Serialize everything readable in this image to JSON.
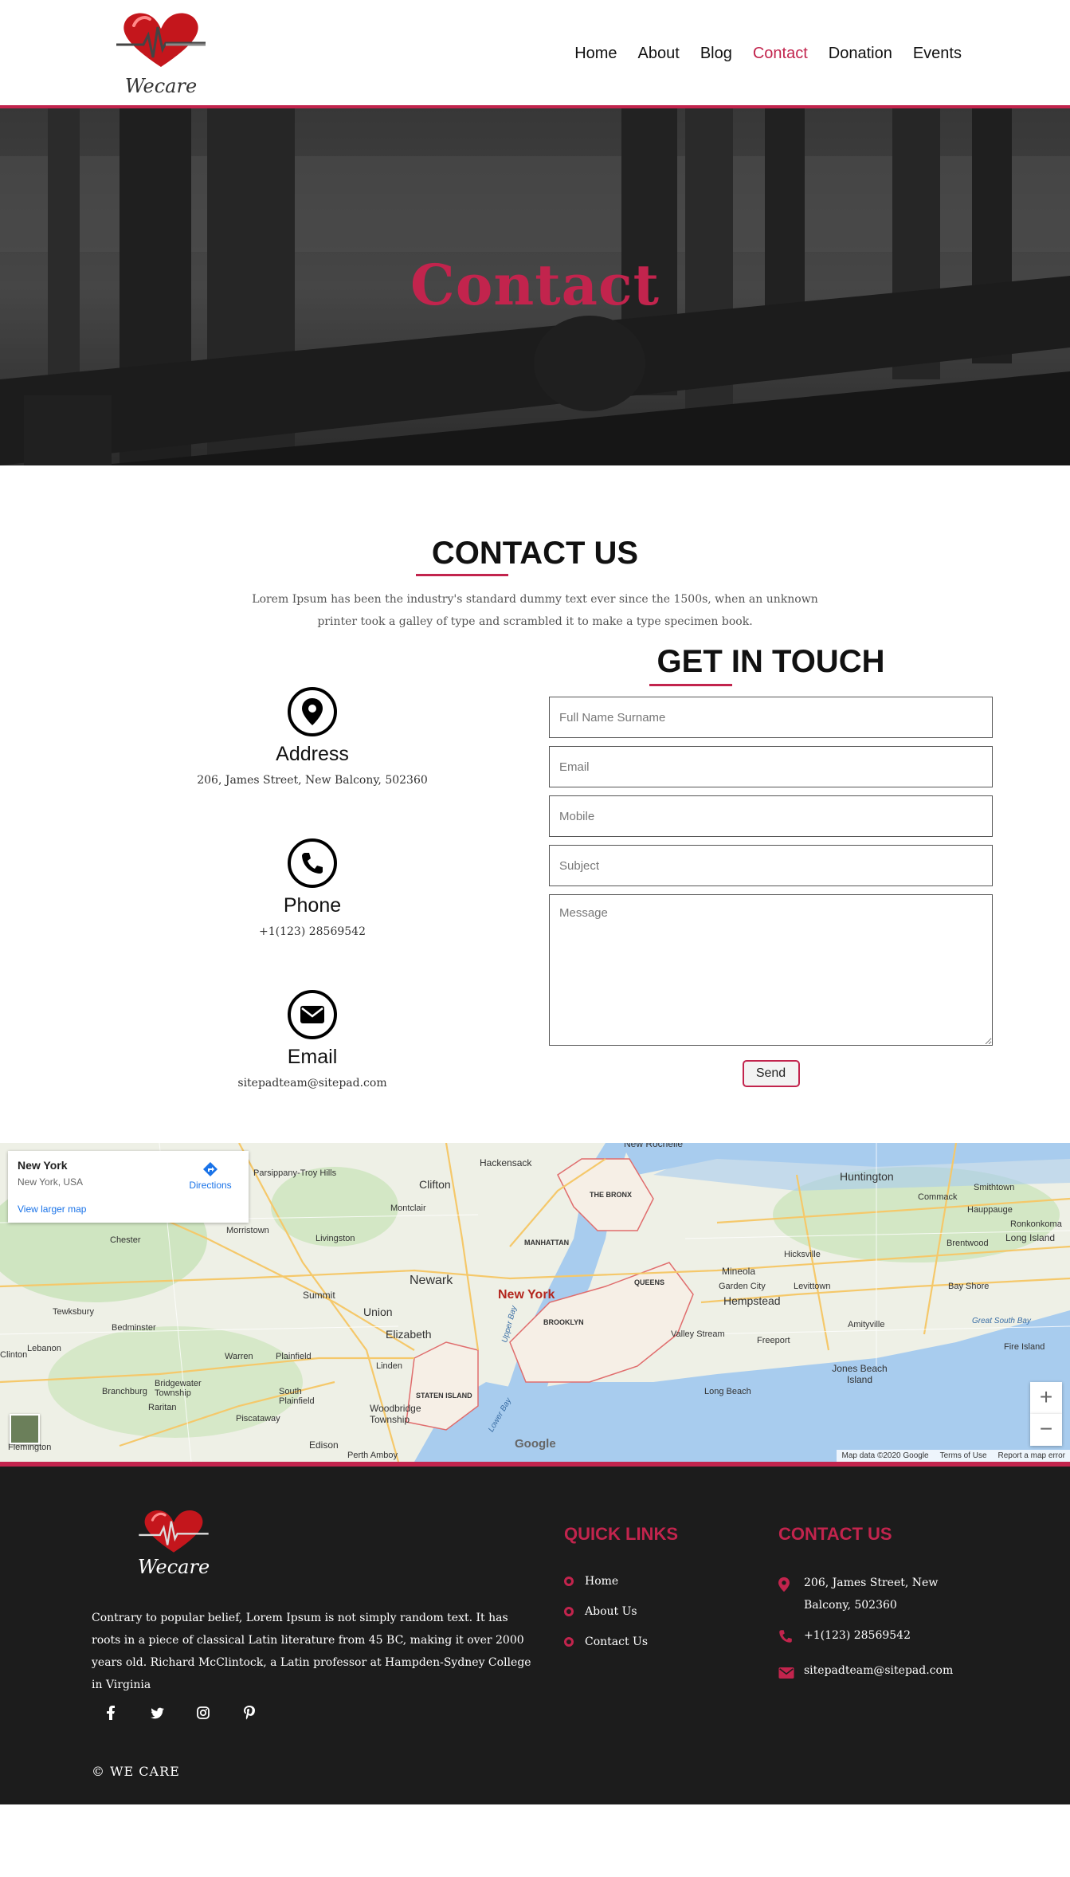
{
  "header": {
    "logo_text": "Wecare",
    "nav": [
      "Home",
      "About",
      "Blog",
      "Contact",
      "Donation",
      "Events"
    ],
    "active_nav": "Contact"
  },
  "hero": {
    "title": "Contact"
  },
  "contact": {
    "title": "CONTACT US",
    "lead": "Lorem Ipsum has been the industry's standard dummy text ever since the 1500s, when an unknown printer took a galley of type and scrambled it to make a type specimen book.",
    "items": [
      {
        "icon": "location-icon",
        "label": "Address",
        "value": "206, James Street, New Balcony, 502360"
      },
      {
        "icon": "phone-icon",
        "label": "Phone",
        "value": "+1(123) 28569542"
      },
      {
        "icon": "envelope-icon",
        "label": "Email",
        "value": "sitepadteam@sitepad.com"
      }
    ]
  },
  "form": {
    "title": "GET IN TOUCH",
    "name_placeholder": "Full Name Surname",
    "email_placeholder": "Email",
    "mobile_placeholder": "Mobile",
    "subject_placeholder": "Subject",
    "message_placeholder": "Message",
    "send_label": "Send"
  },
  "map": {
    "place_name": "New York",
    "place_address": "New York, USA",
    "directions_label": "Directions",
    "larger_map_label": "View larger map",
    "city_label": "New York",
    "zoom_in": "+",
    "zoom_out": "−",
    "google_label": "Google",
    "attribution": [
      "Map data ©2020 Google",
      "Terms of Use",
      "Report a map error"
    ],
    "labels": [
      "New Rochelle",
      "Hackensack",
      "Parsippany-Troy Hills",
      "Clifton",
      "Montclair",
      "Morristown",
      "Livingston",
      "Chester",
      "Newark",
      "Summit",
      "Union",
      "Elizabeth",
      "Tewksbury",
      "Bedminster",
      "Warren",
      "Plainfield",
      "Linden",
      "Bridgewater Township",
      "Branchburg",
      "Raritan",
      "South Plainfield",
      "Piscataway",
      "Woodbridge Township",
      "Edison",
      "Perth Amboy",
      "Flemington",
      "Lebanon",
      "STATEN ISLAND",
      "MANHATTAN",
      "THE BRONX",
      "QUEENS",
      "BROOKLYN",
      "Huntington",
      "Smithtown",
      "Commack",
      "Hauppauge",
      "Ronkonkoma",
      "Long Island",
      "Brentwood",
      "Hicksville",
      "Mineola",
      "Garden City",
      "Hempstead",
      "Levittown",
      "Bay Shore",
      "Amityville",
      "Valley Stream",
      "Freeport",
      "Great South Bay",
      "Fire Island",
      "Jones Beach Island",
      "Long Beach",
      "Lower Bay",
      "Upper Bay",
      "Clinton"
    ]
  },
  "footer": {
    "logo_text": "Wecare",
    "about": "Contrary to popular belief, Lorem Ipsum is not simply random text. It has roots in a piece of classical Latin literature from 45 BC, making it over 2000 years old. Richard McClintock, a Latin professor at Hampden-Sydney College in Virginia",
    "quick_links_title": "QUICK LINKS",
    "quick_links": [
      "Home",
      "About Us",
      "Contact Us"
    ],
    "contact_title": "CONTACT US",
    "contact_items": [
      {
        "icon": "location-icon",
        "value": "206, James Street, New Balcony, 502360"
      },
      {
        "icon": "phone-icon",
        "value": "+1(123) 28569542"
      },
      {
        "icon": "envelope-icon",
        "value": "sitepadteam@sitepad.com"
      }
    ],
    "social": [
      "facebook-icon",
      "twitter-icon",
      "instagram-icon",
      "pinterest-icon"
    ],
    "copyright": "© WE CARE"
  },
  "colors": {
    "accent": "#c2244d",
    "footer_bg": "#1c1c1c"
  }
}
